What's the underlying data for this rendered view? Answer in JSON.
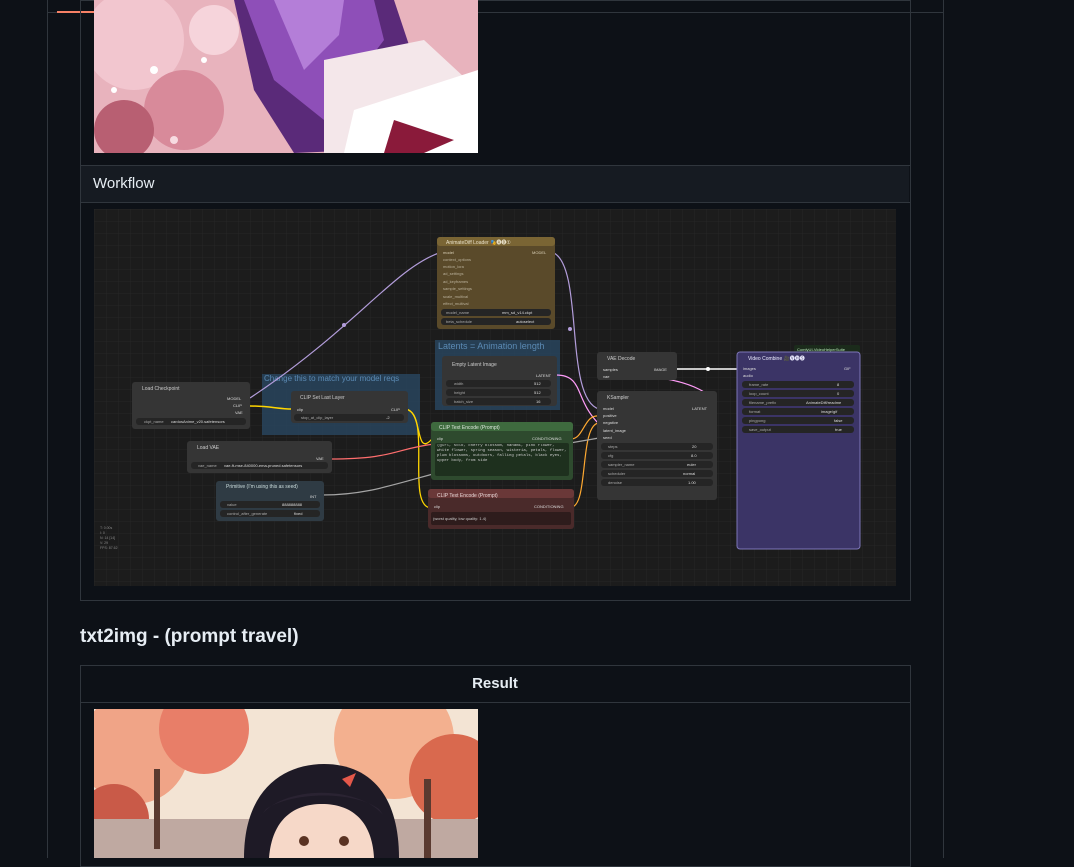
{
  "workflow": {
    "label": "Workflow",
    "nodes": {
      "animatediff_loader": {
        "title": "AnimateDiff Loader 🎭🅐🅓①",
        "output": "MODEL",
        "inputs": [
          "model",
          "context_options",
          "motion_lora",
          "ad_settings",
          "ad_keyframes",
          "sample_settings",
          "scale_multival",
          "effect_multival"
        ],
        "widgets": [
          {
            "name": "model_name",
            "value": "mm_sd_v14.ckpt"
          },
          {
            "name": "beta_schedule",
            "value": "autoselect"
          }
        ]
      },
      "latents_group": {
        "title": "Latents = Animation length"
      },
      "empty_latent": {
        "title": "Empty Latent Image",
        "output": "LATENT",
        "widgets": [
          {
            "name": "width",
            "value": "512"
          },
          {
            "name": "height",
            "value": "512"
          },
          {
            "name": "batch_size",
            "value": "16"
          }
        ]
      },
      "model_group": {
        "title": "Change this to match your model reqs"
      },
      "clip_set_last_layer": {
        "title": "CLIP Set Last Layer",
        "input": "clip",
        "output": "CLIP",
        "widget": {
          "name": "stop_at_clip_layer",
          "value": "-2"
        }
      },
      "load_checkpoint": {
        "title": "Load Checkpoint",
        "outputs": [
          "MODEL",
          "CLIP",
          "VAE"
        ],
        "widget": {
          "name": "ckpt_name",
          "value": "cardosAnime_v20.safetensors"
        }
      },
      "load_vae": {
        "title": "Load VAE",
        "output": "VAE",
        "widget": {
          "name": "vae_name",
          "value": "vae-ft-mse-840000-ema-pruned.safetensors"
        }
      },
      "primitive": {
        "title": "Primitive (I'm using this as seed)",
        "output": "INT",
        "widgets": [
          {
            "name": "value",
            "value": "888888888"
          },
          {
            "name": "control_after_generate",
            "value": "fixed"
          }
        ]
      },
      "clip_text_positive": {
        "title": "CLIP Text Encode (Prompt)",
        "input": "clip",
        "output": "CONDITIONING",
        "text": "(girl, solo, cherry blossom, hanami, pink flower, white flower, spring season, wisteria, petals, flower, plum blossoms, outdoors, falling petals, black eyes, upper body, from side"
      },
      "clip_text_negative": {
        "title": "CLIP Text Encode (Prompt)",
        "input": "clip",
        "output": "CONDITIONING",
        "text": "(worst quality, low quality: 1.4)"
      },
      "vae_decode": {
        "title": "VAE Decode",
        "inputs": [
          "samples",
          "vae"
        ],
        "output": "IMAGE"
      },
      "ksampler": {
        "title": "KSampler",
        "inputs": [
          "model",
          "positive",
          "negative",
          "latent_image",
          "seed"
        ],
        "output": "LATENT",
        "widgets": [
          {
            "name": "steps",
            "value": "20"
          },
          {
            "name": "cfg",
            "value": "8.0"
          },
          {
            "name": "sampler_name",
            "value": "euler"
          },
          {
            "name": "scheduler",
            "value": "normal"
          },
          {
            "name": "denoise",
            "value": "1.00"
          }
        ]
      },
      "video_combine": {
        "badge": "ComfyUI-VideoHelperSuite",
        "title": "Video Combine 🎥🅥🅗🅢",
        "inputs": [
          "images",
          "audio"
        ],
        "output": "GIF",
        "widgets": [
          {
            "name": "frame_rate",
            "value": "8"
          },
          {
            "name": "loop_count",
            "value": "0"
          },
          {
            "name": "filename_prefix",
            "value": "AnimateDiff/readme"
          },
          {
            "name": "format",
            "value": "image/gif"
          },
          {
            "name": "pingpong",
            "value": "false"
          },
          {
            "name": "save_output",
            "value": "true"
          }
        ]
      }
    },
    "stats": [
      "T: 0.00s",
      "I: 0",
      "N: 14 [14]",
      "V: 29",
      "FPS: 87.62"
    ]
  },
  "section": {
    "heading": "txt2img - (prompt travel)"
  },
  "result": {
    "label": "Result"
  },
  "colors": {
    "accent_tab": "#f78166",
    "border": "#30363d",
    "model_link": "#b39ddb",
    "clip_link": "#ffd500",
    "vae_link": "#ff6e6e",
    "latent_link": "#ff9cf9",
    "conditioning_link": "#ffa931"
  }
}
